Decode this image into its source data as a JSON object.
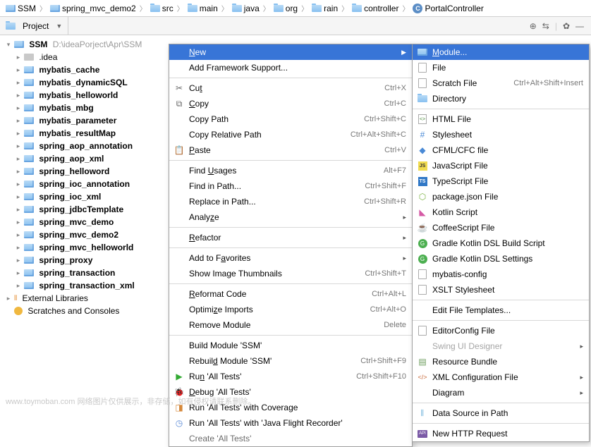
{
  "breadcrumb": {
    "root": "SSM",
    "items": [
      "spring_mvc_demo2",
      "src",
      "main",
      "java",
      "org",
      "rain",
      "controller"
    ],
    "file": "PortalController",
    "file_initial": "C"
  },
  "toolbar": {
    "title": "Project"
  },
  "tree": {
    "root": "SSM",
    "root_path": "D:\\ideaPorject\\Apr\\SSM",
    "idea_folder": ".idea",
    "modules": [
      "mybatis_cache",
      "mybatis_dynamicSQL",
      "mybatis_helloworld",
      "mybatis_mbg",
      "mybatis_parameter",
      "mybatis_resultMap",
      "spring_aop_annotation",
      "spring_aop_xml",
      "spring_helloword",
      "spring_ioc_annotation",
      "spring_ioc_xml",
      "spring_jdbcTemplate",
      "spring_mvc_demo",
      "spring_mvc_demo2",
      "spring_mvc_helloworld",
      "spring_proxy",
      "spring_transaction",
      "spring_transaction_xml"
    ],
    "external": "External Libraries",
    "scratches": "Scratches and Consoles"
  },
  "menu1": {
    "new": "New",
    "addfw": "Add Framework Support...",
    "cut": "Cut",
    "cut_sc": "Ctrl+X",
    "copy": "Copy",
    "copy_sc": "Ctrl+C",
    "copypath": "Copy Path",
    "copypath_sc": "Ctrl+Shift+C",
    "copyrp": "Copy Relative Path",
    "copyrp_sc": "Ctrl+Alt+Shift+C",
    "paste": "Paste",
    "paste_sc": "Ctrl+V",
    "findu": "Find Usages",
    "findu_sc": "Alt+F7",
    "findp": "Find in Path...",
    "findp_sc": "Ctrl+Shift+F",
    "replp": "Replace in Path...",
    "replp_sc": "Ctrl+Shift+R",
    "analyze": "Analyze",
    "refactor": "Refactor",
    "addfav": "Add to Favorites",
    "showthumb": "Show Image Thumbnails",
    "showthumb_sc": "Ctrl+Shift+T",
    "reformat": "Reformat Code",
    "reformat_sc": "Ctrl+Alt+L",
    "optimize": "Optimize Imports",
    "optimize_sc": "Ctrl+Alt+O",
    "remove": "Remove Module",
    "remove_sc": "Delete",
    "buildm": "Build Module 'SSM'",
    "rebuildm": "Rebuild Module 'SSM'",
    "rebuildm_sc": "Ctrl+Shift+F9",
    "run": "Run 'All Tests'",
    "run_sc": "Ctrl+Shift+F10",
    "debug": "Debug 'All Tests'",
    "runcov": "Run 'All Tests' with Coverage",
    "runjfr": "Run 'All Tests' with 'Java Flight Recorder'",
    "create": "Create 'All Tests'"
  },
  "menu2": {
    "module": "Module...",
    "file": "File",
    "scratch": "Scratch File",
    "scratch_sc": "Ctrl+Alt+Shift+Insert",
    "dir": "Directory",
    "html": "HTML File",
    "stylesheet": "Stylesheet",
    "cfml": "CFML/CFC file",
    "js": "JavaScript File",
    "ts": "TypeScript File",
    "pkgjson": "package.json File",
    "kts": "Kotlin Script",
    "coffee": "CoffeeScript File",
    "gkdslbs": "Gradle Kotlin DSL Build Script",
    "gkdsls": "Gradle Kotlin DSL Settings",
    "mybatis": "mybatis-config",
    "xslt": "XSLT Stylesheet",
    "efiletmpl": "Edit File Templates...",
    "editorcfg": "EditorConfig File",
    "swing": "Swing UI Designer",
    "resbundle": "Resource Bundle",
    "xmlcfg": "XML Configuration File",
    "diagram": "Diagram",
    "dsip": "Data Source in Path",
    "http": "New HTTP Request"
  },
  "watermark": "www.toymoban.com   网络图片仅供展示，非存储，如有侵权请联系删除。"
}
